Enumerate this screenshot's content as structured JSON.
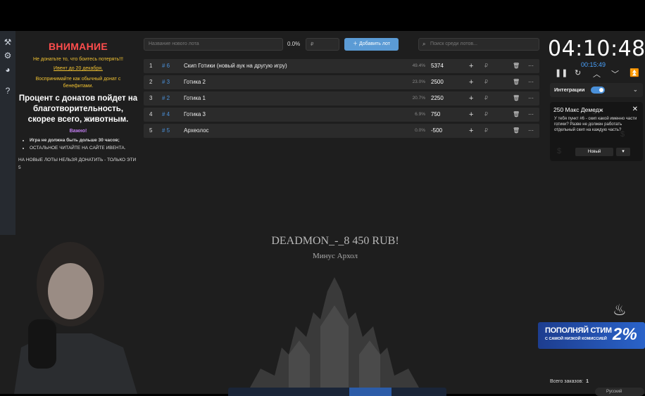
{
  "info": {
    "title": "ВНИМАНИЕ",
    "line1": "Не донатьте то, что боитесь потерять!!!",
    "line2": "Ивент до 20 декабря.",
    "line3": "Воспринимайте как обычный донат с",
    "line4": "бенефитами.",
    "main": "Процент с донатов пойдет на благотворительность, скорее всего, животным.",
    "important": "Важно!",
    "bullets": [
      "Игра не должна быть дольше 30 часов;",
      "ОСТАЛЬНОЕ ЧИТАЙТЕ НА САЙТЕ ИВЕНТА."
    ],
    "note": "НА НОВЫЕ ЛОТЫ НЕЛЬЗЯ ДОНАТИТЬ - ТОЛЬКО ЭТИ 5"
  },
  "addbar": {
    "lot_placeholder": "Название нового лота",
    "percent": "0.0%",
    "price_placeholder": "₽",
    "add_label": "Добавить лот",
    "search_placeholder": "Поиск среди лотов..."
  },
  "lots": [
    {
      "num": "1",
      "id": "# 6",
      "name": "Скип Готики (новый аук на другую игру)",
      "percent": "49.4%",
      "amount": "5374"
    },
    {
      "num": "2",
      "id": "# 3",
      "name": "Готика 2",
      "percent": "23.0%",
      "amount": "2500"
    },
    {
      "num": "3",
      "id": "# 2",
      "name": "Готика 1",
      "percent": "20.7%",
      "amount": "2250"
    },
    {
      "num": "4",
      "id": "# 4",
      "name": "Готика 3",
      "percent": "6.9%",
      "amount": "750"
    },
    {
      "num": "5",
      "id": "# 5",
      "name": "Археолос",
      "percent": "0.0%",
      "amount": "-500"
    }
  ],
  "center": {
    "line1": "DEADMON_-_8 450 RUB!",
    "line2": "Минус Архол"
  },
  "timer": {
    "main": "04:10:48",
    "sub": "00:15:49"
  },
  "integrations": {
    "label": "Интеграции"
  },
  "donation": {
    "title": "250 Макс Демедж",
    "message": "У тебя пункт #6 - скип какой именно части готики? Разве не должен работать отдельный скип на каждую часть?",
    "select": "Новый"
  },
  "promo": {
    "line1": "ПОПОЛНЯЙ СТИМ",
    "line2": "С САМОЙ НИЗКОЙ КОМИССИЕЙ",
    "percent": "2%"
  },
  "footer": {
    "orders_label": "Всего заказов:",
    "orders_value": "1",
    "language": "Русский"
  }
}
